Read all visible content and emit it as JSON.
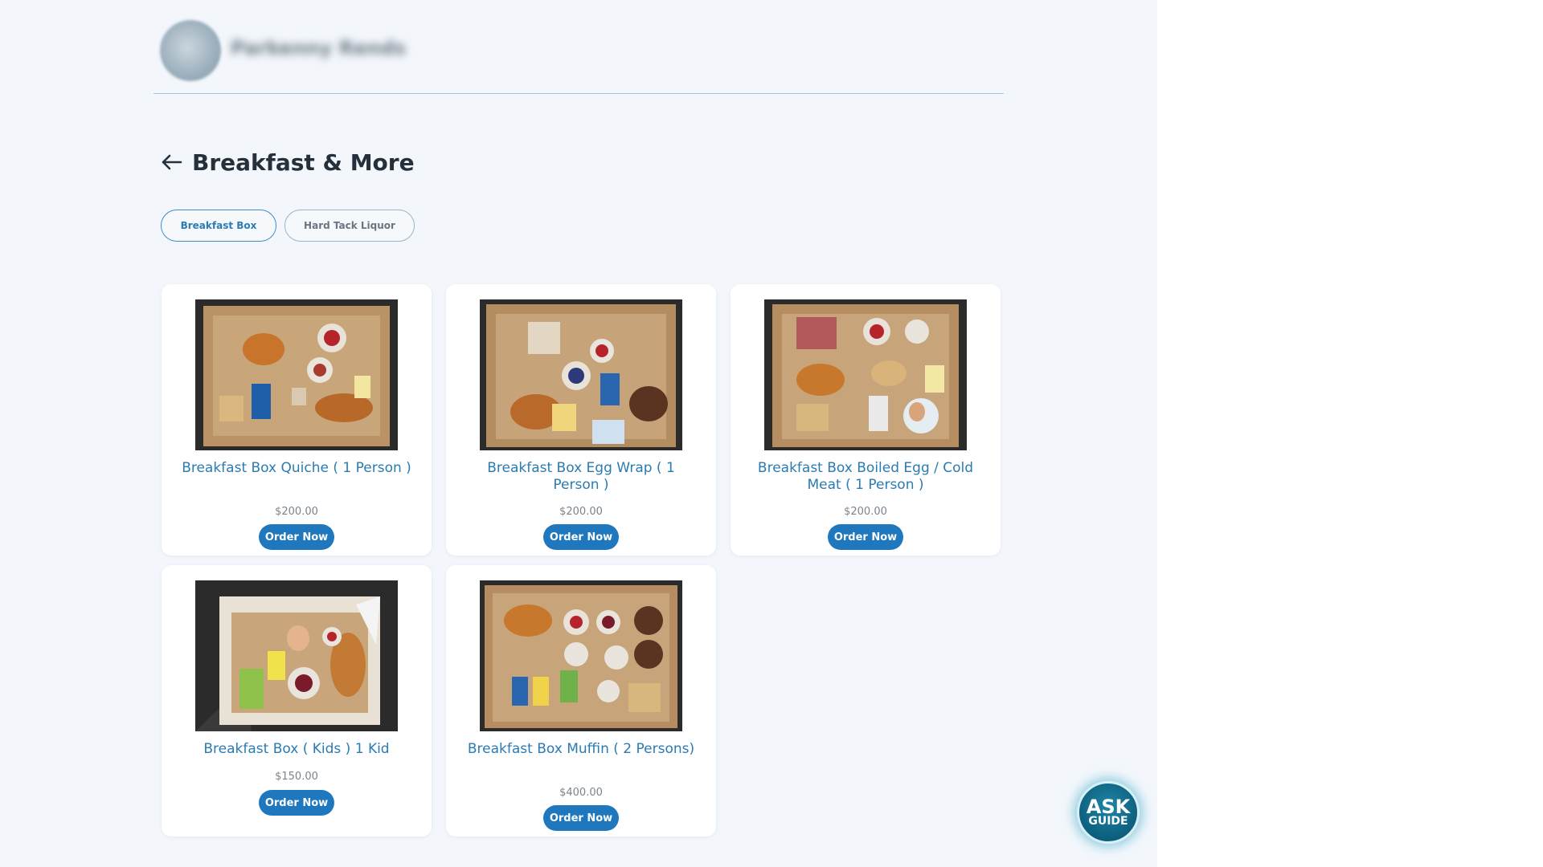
{
  "header": {
    "username": "Parkenny Rends"
  },
  "page": {
    "title": "Breakfast & More"
  },
  "tabs": [
    {
      "label": "Breakfast Box",
      "active": true
    },
    {
      "label": "Hard Tack Liquor",
      "active": false
    }
  ],
  "products": [
    {
      "name": "Breakfast Box Quiche ( 1 Person )",
      "price": "$200.00",
      "button": "Order Now"
    },
    {
      "name": "Breakfast Box Egg Wrap ( 1 Person )",
      "price": "$200.00",
      "button": "Order Now"
    },
    {
      "name": "Breakfast Box Boiled Egg / Cold Meat ( 1 Person )",
      "price": "$200.00",
      "button": "Order Now"
    },
    {
      "name": "Breakfast Box ( Kids ) 1 Kid",
      "price": "$150.00",
      "button": "Order Now"
    },
    {
      "name": "Breakfast Box Muffin ( 2 Persons)",
      "price": "$400.00",
      "button": "Order Now"
    }
  ],
  "ask_guide": {
    "line1": "ASK",
    "line2": "GUIDE"
  },
  "colors": {
    "accent": "#1f78bd",
    "link": "#2a7bb2",
    "background": "#f3f7fc"
  }
}
